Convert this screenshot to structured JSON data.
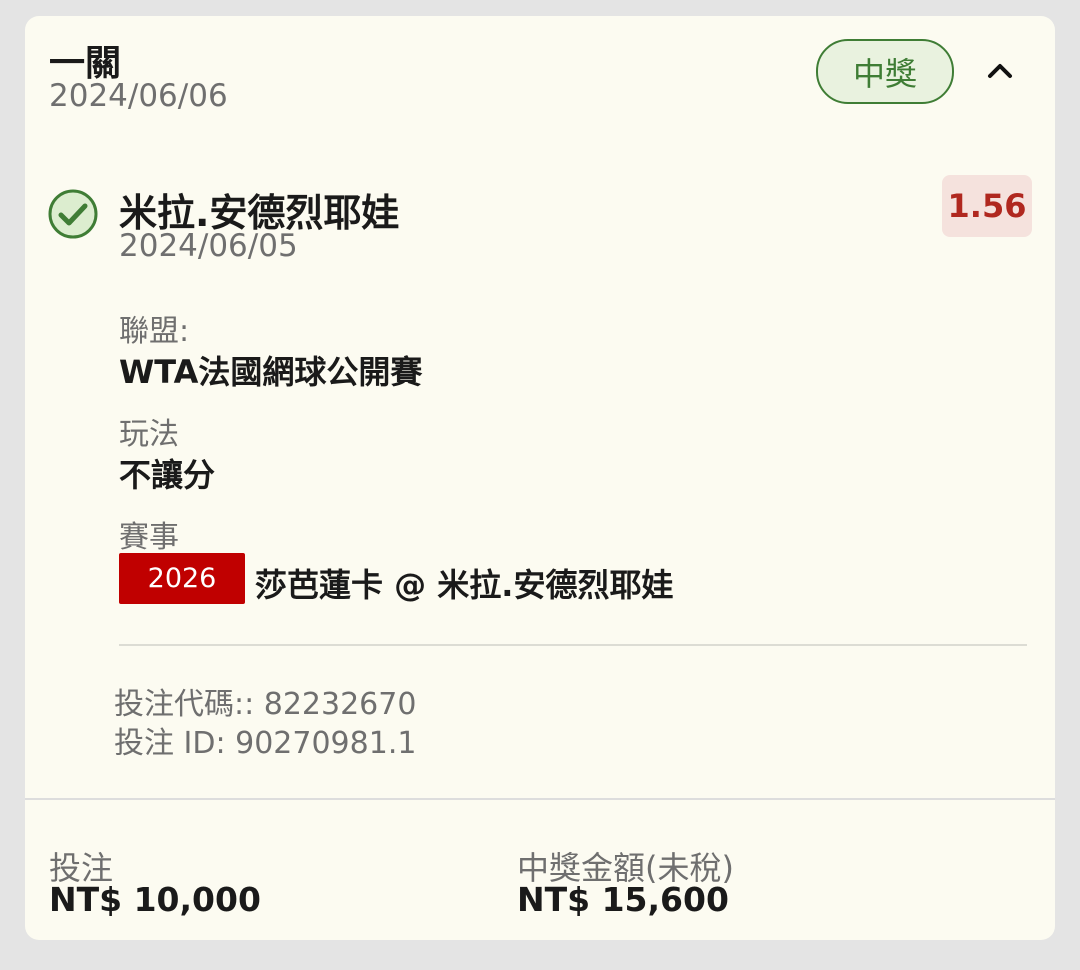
{
  "header": {
    "bet_type": "一關",
    "date": "2024/06/06",
    "status": "中獎"
  },
  "selection": {
    "name": "米拉.安德烈耶娃",
    "date": "2024/06/05",
    "odds": "1.56"
  },
  "details": {
    "league_label": "聯盟:",
    "league_value": "WTA法國網球公開賽",
    "market_label": "玩法",
    "market_value": "不讓分",
    "event_label": "賽事",
    "event_id": "2026",
    "event_name": "莎芭蓮卡 @ 米拉.安德烈耶娃"
  },
  "meta": {
    "bet_code": "投注代碼:: 82232670",
    "bet_id": "投注 ID: 90270981.1"
  },
  "footer": {
    "stake_label": "投注",
    "stake_value": "NT$ 10,000",
    "payout_label": "中獎金額(未稅)",
    "payout_value": "NT$ 15,600"
  },
  "colors": {
    "card_bg": "#fcfbf1",
    "page_bg": "#e4e4e4",
    "win_green": "#3f7d35",
    "odds_red": "#b0281f",
    "event_badge_red": "#c00000"
  },
  "icons": {
    "collapse": "chevron-up-icon",
    "status": "check-circle-icon"
  }
}
